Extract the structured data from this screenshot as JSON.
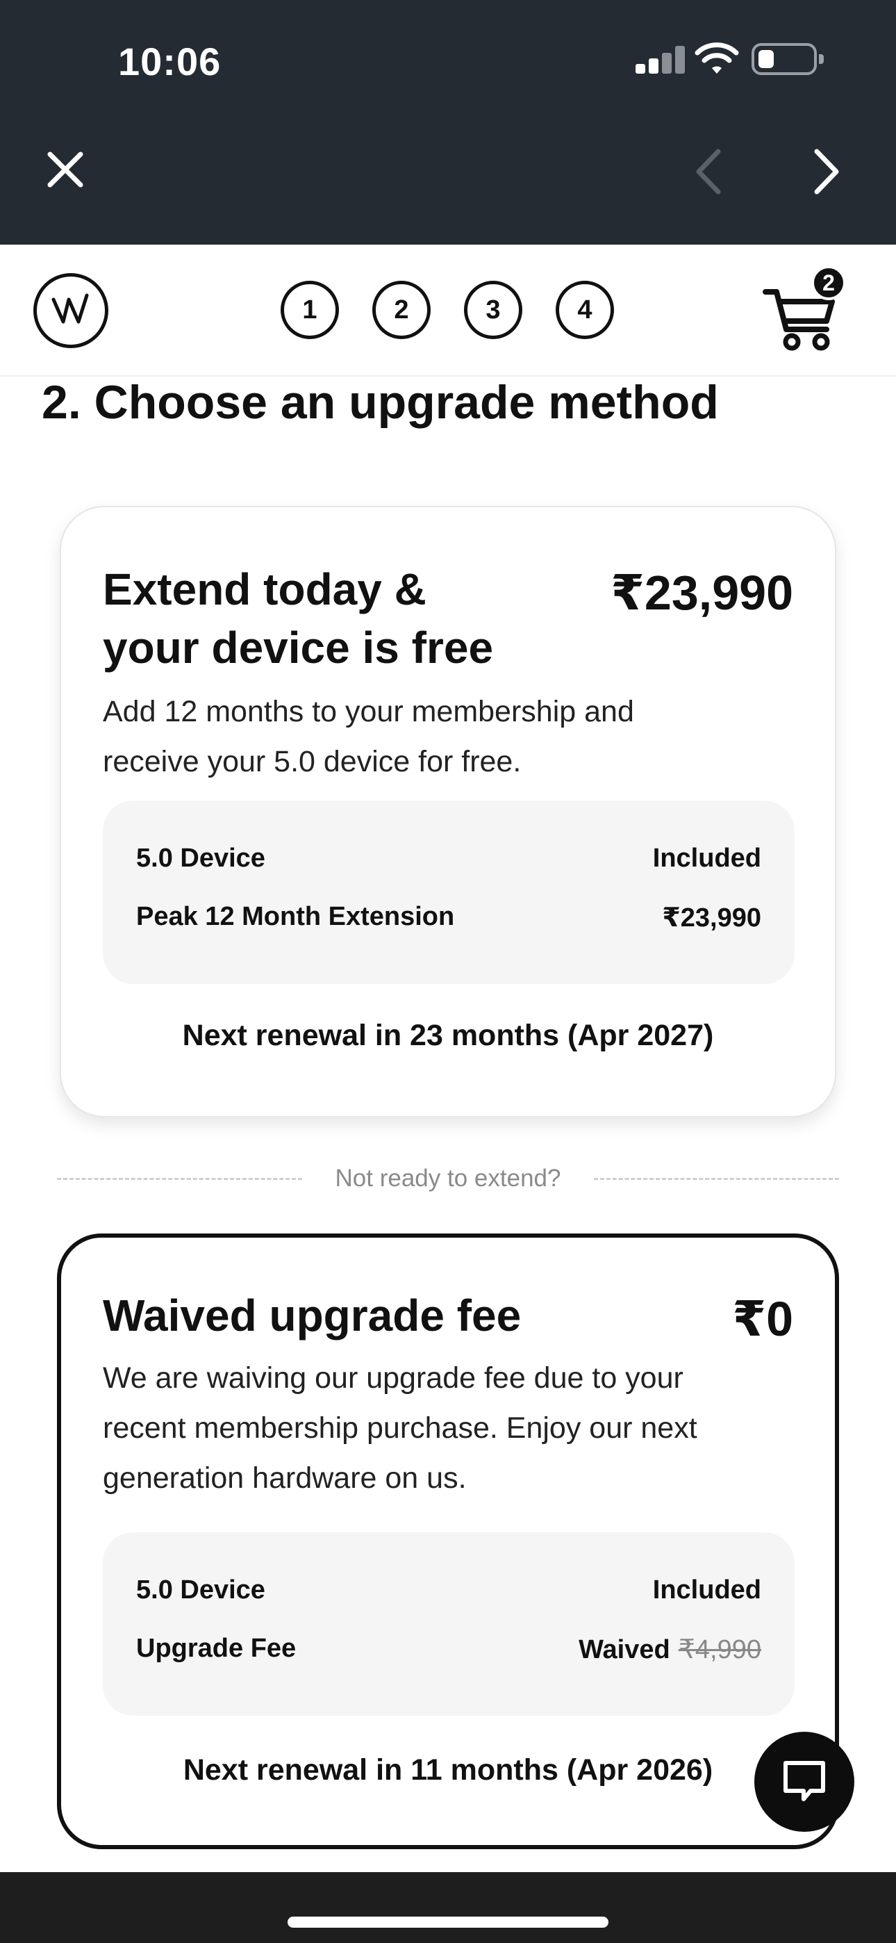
{
  "status_bar": {
    "time": "10:06"
  },
  "header": {
    "steps": [
      "1",
      "2",
      "3",
      "4"
    ],
    "cart_count": "2"
  },
  "section_title": "2. Choose an upgrade method",
  "option_extend": {
    "title_line1": "Extend today &",
    "title_line2": "your device is free",
    "price": "₹23,990",
    "desc_line1": "Add 12 months to your membership and",
    "desc_line2": "receive your 5.0 device for free.",
    "rows": [
      {
        "label": "5.0 Device",
        "value": "Included"
      },
      {
        "label": "Peak 12 Month Extension",
        "value": "₹23,990"
      }
    ],
    "renewal": "Next renewal in 23 months (Apr 2027)"
  },
  "divider_text": "Not ready to extend?",
  "option_waived": {
    "title": "Waived upgrade fee",
    "price": "₹0",
    "desc_line1": "We are waiving our upgrade fee due to your",
    "desc_line2": "recent membership purchase. Enjoy our next",
    "desc_line3": "generation hardware on us.",
    "rows": [
      {
        "label": "5.0 Device",
        "value": "Included"
      },
      {
        "label": "Upgrade Fee",
        "value": "Waived",
        "original": "₹4,990"
      }
    ],
    "renewal": "Next renewal in 11 months (Apr 2026)"
  },
  "colors": {
    "top_bar": "#252b33",
    "accent": "#111111",
    "panel": "#f5f5f5"
  },
  "icons": [
    "close-icon",
    "chevron-left-icon",
    "chevron-right-icon",
    "logo-icon",
    "cart-icon",
    "chat-icon",
    "wifi-icon",
    "signal-icon",
    "battery-icon"
  ]
}
